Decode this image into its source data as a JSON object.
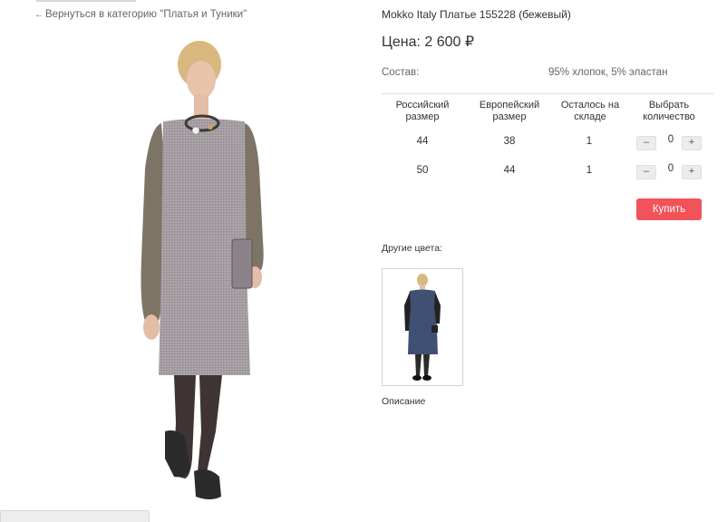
{
  "nav": {
    "back_arrow": "←",
    "back_label": "Вернуться в категорию \"Платья и Туники\""
  },
  "product": {
    "title": "Mokko Italy Платье 155228 (бежевый)",
    "price": "Цена: 2 600 ₽",
    "composition_label": "Состав:",
    "composition_value": "95% хлопок, 5% эластан"
  },
  "sizes_table": {
    "headers": [
      "Российский размер",
      "Европейский размер",
      "Осталось на складе",
      "Выбрать количество"
    ],
    "rows": [
      {
        "ru": "44",
        "eu": "38",
        "stock": "1",
        "qty": "0"
      },
      {
        "ru": "50",
        "eu": "44",
        "stock": "1",
        "qty": "0"
      }
    ],
    "minus": "–",
    "plus": "+"
  },
  "buy_label": "Купить",
  "other_colors_label": "Другие цвета:",
  "description_label": "Описание",
  "colors": {
    "accent": "#f2525a",
    "text": "#333333",
    "muted": "#666666"
  },
  "icons": [
    "arrow-left-icon",
    "minus-icon",
    "plus-icon"
  ]
}
